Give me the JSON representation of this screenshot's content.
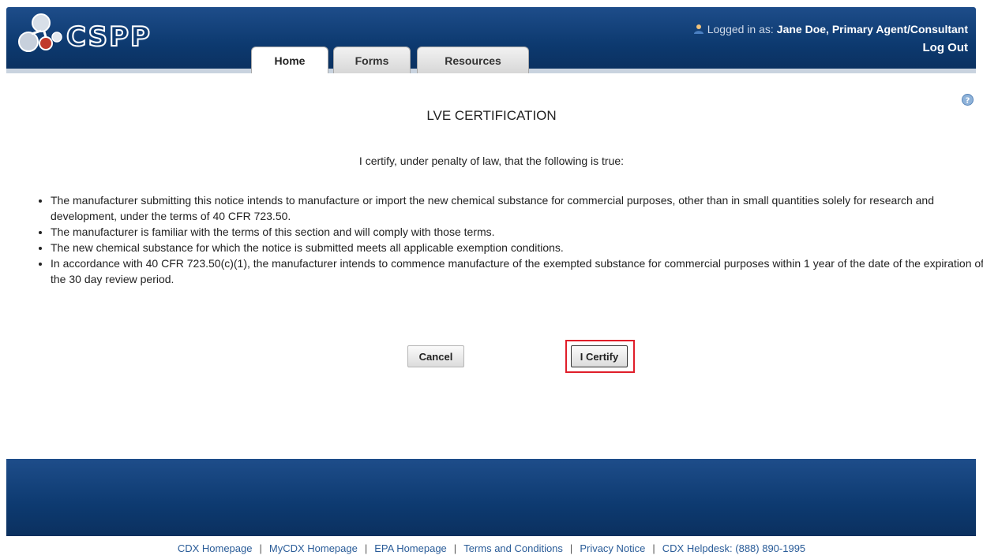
{
  "app": {
    "logo_text": "CSPP"
  },
  "tabs": [
    {
      "label": "Home",
      "active": true
    },
    {
      "label": "Forms",
      "active": false
    },
    {
      "label": "Resources",
      "active": false
    }
  ],
  "user": {
    "icon": "user-icon",
    "logged_in_label": "Logged in as:",
    "name": "Jane Doe, Primary Agent/Consultant",
    "logout_label": "Log Out"
  },
  "help": {
    "icon": "help-icon"
  },
  "main": {
    "title": "LVE CERTIFICATION",
    "intro": "I certify, under penalty of law, that the following is true:",
    "bullets": [
      "The manufacturer submitting this notice intends to manufacture or import the new chemical substance for commercial purposes, other than in small quantities solely for research and development, under the terms of 40 CFR 723.50.",
      "The manufacturer is familiar with the terms of this section and will comply with those terms.",
      "The new chemical substance for which the notice is submitted meets all applicable exemption conditions.",
      "In accordance with 40 CFR 723.50(c)(1), the manufacturer intends to commence manufacture of the exempted substance for commercial purposes within 1 year of the date of the expiration of the 30 day review period."
    ],
    "cancel_label": "Cancel",
    "certify_label": "I Certify"
  },
  "footer": {
    "links": [
      "CDX Homepage",
      "MyCDX Homepage",
      "EPA Homepage",
      "Terms and Conditions",
      "Privacy Notice",
      "CDX Helpdesk: (888) 890-1995"
    ],
    "separator": "|"
  },
  "colors": {
    "header_blue": "#0d3a70",
    "highlight_red": "#e01e2a",
    "link_blue": "#2a5c98"
  }
}
